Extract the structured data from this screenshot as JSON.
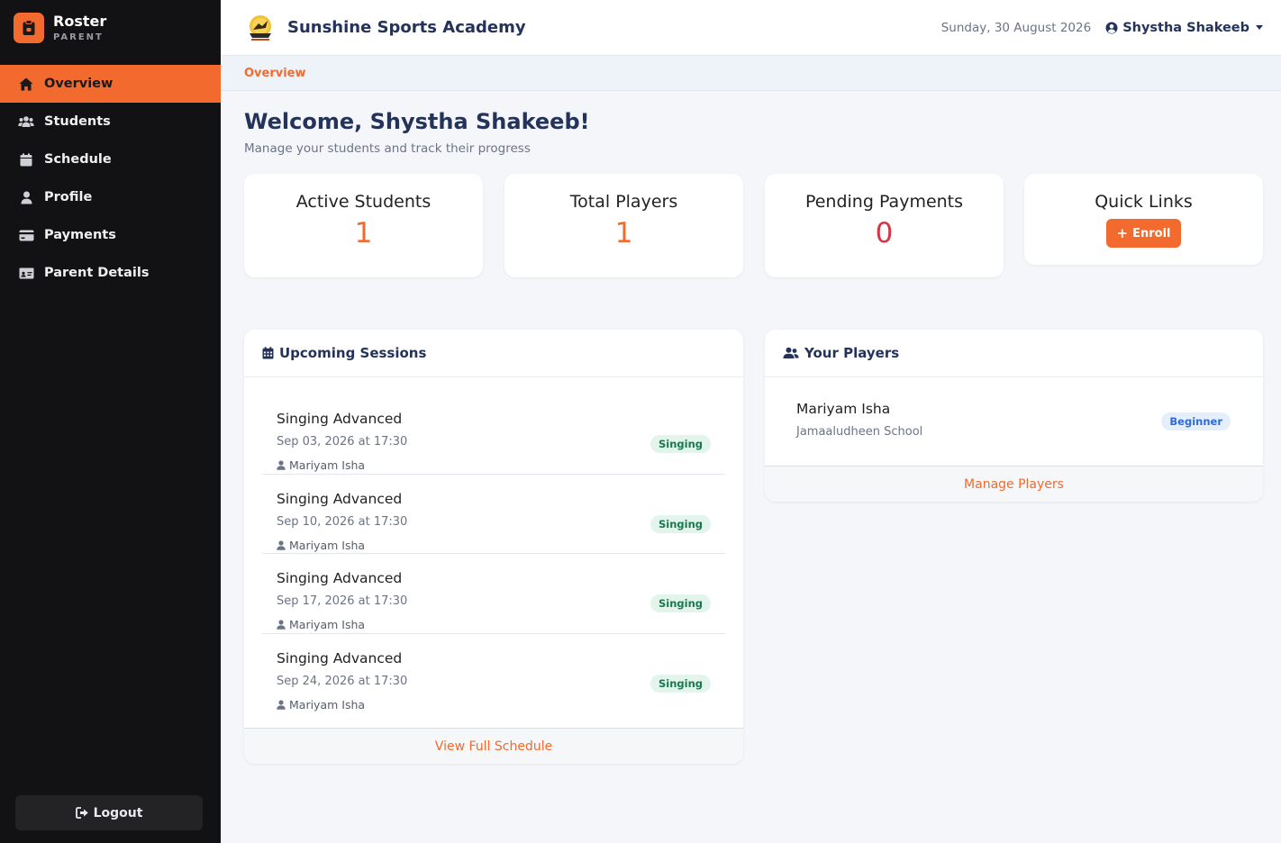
{
  "brand": {
    "title": "Roster",
    "subtitle": "PARENT"
  },
  "sidebar": {
    "items": [
      {
        "label": "Overview",
        "icon": "home-icon",
        "active": true
      },
      {
        "label": "Students",
        "icon": "users-icon"
      },
      {
        "label": "Schedule",
        "icon": "calendar-icon"
      },
      {
        "label": "Profile",
        "icon": "user-icon"
      },
      {
        "label": "Payments",
        "icon": "credit-card-icon"
      },
      {
        "label": "Parent Details",
        "icon": "id-card-icon"
      }
    ],
    "logout_label": "Logout"
  },
  "header": {
    "academy_name": "Sunshine Sports Academy",
    "date": "Sunday, 30 August 2026",
    "user_name": "Shystha Shakeeb"
  },
  "breadcrumb": {
    "current": "Overview"
  },
  "welcome": {
    "title": "Welcome, Shystha Shakeeb!",
    "subtitle": "Manage your students and track their progress"
  },
  "stats": [
    {
      "label": "Active Students",
      "value": "1"
    },
    {
      "label": "Total Players",
      "value": "1"
    },
    {
      "label": "Pending Payments",
      "value": "0"
    },
    {
      "label": "Quick Links",
      "button_label": "Enroll"
    }
  ],
  "sessions": {
    "title": "Upcoming Sessions",
    "items": [
      {
        "title": "Singing Advanced",
        "time": "Sep 03, 2026 at 17:30",
        "student": "Mariyam Isha",
        "tag": "Singing"
      },
      {
        "title": "Singing Advanced",
        "time": "Sep 10, 2026 at 17:30",
        "student": "Mariyam Isha",
        "tag": "Singing"
      },
      {
        "title": "Singing Advanced",
        "time": "Sep 17, 2026 at 17:30",
        "student": "Mariyam Isha",
        "tag": "Singing"
      },
      {
        "title": "Singing Advanced",
        "time": "Sep 24, 2026 at 17:30",
        "student": "Mariyam Isha",
        "tag": "Singing"
      }
    ],
    "footer_link": "View Full Schedule"
  },
  "players": {
    "title": "Your Players",
    "items": [
      {
        "name": "Mariyam Isha",
        "school": "Jamaaludheen School",
        "level": "Beginner"
      }
    ],
    "footer_link": "Manage Players"
  },
  "colors": {
    "accent": "#f26a2e",
    "sidebar_bg": "#121214",
    "navy": "#24335a",
    "danger": "#d63447"
  }
}
